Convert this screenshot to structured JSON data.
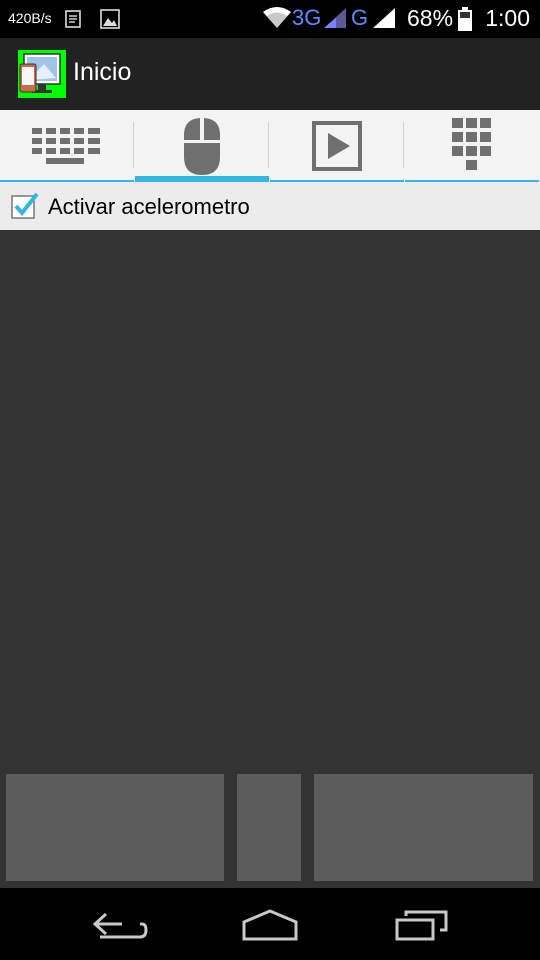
{
  "status_bar": {
    "speed": "420B/s",
    "network_3g": "3G",
    "network_g": "G",
    "battery_pct": "68%",
    "time": "1:00",
    "icons": [
      "notes-icon",
      "image-icon",
      "wifi-icon",
      "signal-icon",
      "signal-icon",
      "battery-icon"
    ]
  },
  "action_bar": {
    "title": "Inicio",
    "app_icon": "app-launcher-icon"
  },
  "tabs": [
    {
      "icon": "keyboard-icon",
      "active": false
    },
    {
      "icon": "mouse-icon",
      "active": true
    },
    {
      "icon": "play-icon",
      "active": false
    },
    {
      "icon": "keypad-icon",
      "active": false
    }
  ],
  "accelerometer": {
    "label": "Activar acelerometro",
    "checked": true
  },
  "mouse_buttons": [
    "left-click-button",
    "middle-button",
    "right-click-button"
  ],
  "nav_bar": [
    "back-icon",
    "home-icon",
    "recents-icon"
  ],
  "colors": {
    "accent": "#33b5e5",
    "tab_icon": "#6f6f6f",
    "touchpad_bg": "#333333",
    "mouse_button": "#5c5c5c"
  }
}
